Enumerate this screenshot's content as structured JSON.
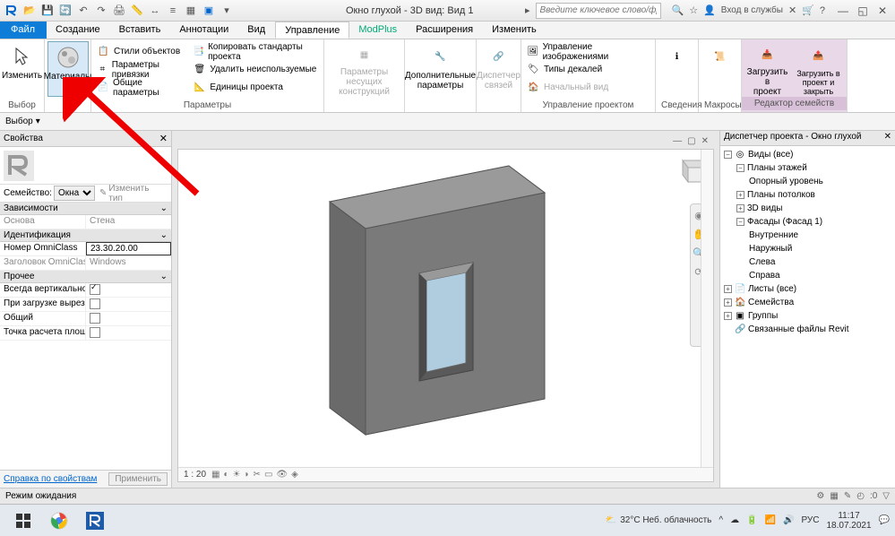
{
  "title": "Окно глухой - 3D вид: Вид 1",
  "search_placeholder": "Введите ключевое слово/фразу",
  "login_text": "Вход в службы",
  "tabs": {
    "file": "Файл",
    "create": "Создание",
    "insert": "Вставить",
    "annotate": "Аннотации",
    "view": "Вид",
    "manage": "Управление",
    "modplus": "ModPlus",
    "extensions": "Расширения",
    "modify": "Изменить"
  },
  "ribbon": {
    "modify_btn": "Изменить",
    "materials_btn": "Материалы",
    "select_label": "Выбор",
    "obj_styles": "Стили объектов",
    "snap_params": "Параметры привязки",
    "shared_params": "Общие параметры",
    "copy_standards": "Копировать стандарты проекта",
    "remove_unused": "Удалить неиспользуемые",
    "project_units": "Единицы проекта",
    "params_label": "Параметры",
    "bearing_params": "Параметры\nнесущих конструкций",
    "extra_params": "Дополнительные\nпараметры",
    "dispatcher": "Диспетчер\nсвязей",
    "manage_images": "Управление изображениями",
    "decal_types": "Типы декалей",
    "start_view": "Начальный вид",
    "manage_project": "Управление проектом",
    "info": "Сведения",
    "macros": "Макросы",
    "load_project": "Загрузить в\nпроект",
    "load_close": "Загрузить в\nпроект и закрыть",
    "family_editor": "Редактор семейств"
  },
  "options_bar": "Выбор",
  "props": {
    "title": "Свойства",
    "family_label": "Семейство:",
    "family_value": "Окна",
    "edit_type": "Изменить тип",
    "grp_constraints": "Зависимости",
    "base_k": "Основа",
    "base_v": "Стена",
    "grp_identity": "Идентификация",
    "omni_num_k": "Номер OmniClass",
    "omni_num_v": "23.30.20.00",
    "omni_head_k": "Заголовок OmniClass",
    "omni_head_v": "Windows",
    "grp_other": "Прочее",
    "always_vert": "Всегда вертикально",
    "on_load_cut": "При загрузке вырез...",
    "shared": "Общий",
    "calc_point": "Точка расчета площ...",
    "help_link": "Справка по свойствам",
    "apply": "Применить"
  },
  "vp": {
    "scale": "1 : 20"
  },
  "pb": {
    "title": "Диспетчер проекта - Окно глухой",
    "views_all": "Виды (все)",
    "floor_plans": "Планы этажей",
    "ref_level": "Опорный уровень",
    "ceiling_plans": "Планы потолков",
    "views_3d": "3D виды",
    "elevations": "Фасады (Фасад 1)",
    "interior": "Внутренние",
    "exterior": "Наружный",
    "left": "Слева",
    "right": "Справа",
    "sheets": "Листы (все)",
    "families": "Семейства",
    "groups": "Группы",
    "revit_links": "Связанные файлы Revit"
  },
  "status": {
    "msg": "Режим ожидания"
  },
  "taskbar": {
    "weather": "32°C  Неб. облачность",
    "lang": "РУС",
    "time": "11:17",
    "date": "18.07.2021"
  }
}
